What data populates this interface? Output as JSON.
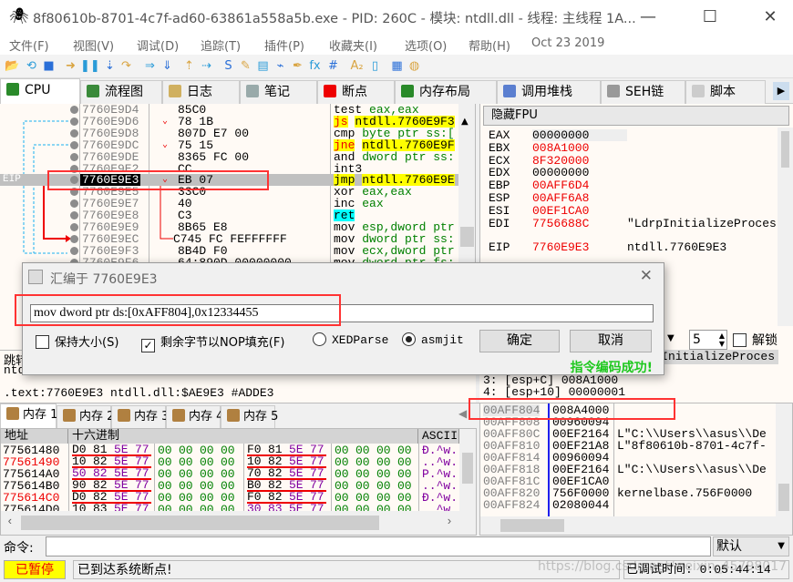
{
  "window": {
    "title": "8f80610b-8701-4c7f-ad60-63861a558a5b.exe - PID: 260C - 模块: ntdll.dll - 线程: 主线程 1A...",
    "minimize": "—",
    "maximize": "☐",
    "close": "✕"
  },
  "menu": [
    "文件(F)",
    "视图(V)",
    "调试(D)",
    "追踪(T)",
    "插件(P)",
    "收藏夹(I)",
    "选项(O)",
    "帮助(H)",
    "Oct 23 2019"
  ],
  "toolbar_icons": [
    "open-icon",
    "restart-icon",
    "stop-icon",
    "run-icon",
    "pause-icon",
    "step-into-icon",
    "step-over-icon",
    "trace-into-icon",
    "trace-over-icon",
    "run-to-user-icon",
    "animate-icon",
    "scylla-icon",
    "patch-icon",
    "comment-icon",
    "label-icon",
    "bookmark-icon",
    "function-icon",
    "hash-icon",
    "strings-icon",
    "calc-icon",
    "memory-icon",
    "globe-icon"
  ],
  "toolbar_glyphs": [
    "📂",
    "⟲",
    "■",
    "➜",
    "❚❚",
    "⇣",
    "↷",
    "⇒",
    "⇓",
    "⇡",
    "⇢",
    "S",
    "✎",
    "▤",
    "⌁",
    "✒",
    "fx",
    "#",
    "A₂",
    "▯",
    "▦",
    "◍"
  ],
  "tabs": [
    {
      "label": "CPU",
      "color": "#2a8a2a"
    },
    {
      "label": "流程图",
      "color": "#3a8a3a"
    },
    {
      "label": "日志",
      "color": "#d0b060"
    },
    {
      "label": "笔记",
      "color": "#9aa"
    },
    {
      "label": "断点",
      "color": "#e00"
    },
    {
      "label": "内存布局",
      "color": "#2a8a2a"
    },
    {
      "label": "调用堆栈",
      "color": "#5b7fd0"
    },
    {
      "label": "SEH链",
      "color": "#999"
    },
    {
      "label": "脚本",
      "color": "#ccc"
    }
  ],
  "disasm": {
    "eip_label": "EIP",
    "rows": [
      {
        "addr": "7760E9D4",
        "bytes": "85C0",
        "mn": "test",
        "op": "eax,eax"
      },
      {
        "addr": "7760E9D6",
        "bytes": "78 1B",
        "mn": "js",
        "op": "ntdll.7760E9F3",
        "jump": true
      },
      {
        "addr": "7760E9D8",
        "bytes": "807D E7 00",
        "mn": "cmp",
        "op": "byte ptr ss:["
      },
      {
        "addr": "7760E9DC",
        "bytes": "75 15",
        "mn": "jne",
        "op": "ntdll.7760E9F",
        "jump": true
      },
      {
        "addr": "7760E9DE",
        "bytes": "8365 FC 00",
        "mn": "and",
        "op": "dword ptr ss:"
      },
      {
        "addr": "7760E9E2",
        "bytes": "CC",
        "mn": "int3",
        "op": ""
      },
      {
        "addr": "7760E9E3",
        "bytes": "EB 07",
        "mn": "jmp",
        "op": "ntdll.7760E9E",
        "jump": true,
        "selected": true
      },
      {
        "addr": "7760E9E5",
        "bytes": "33C0",
        "mn": "xor",
        "op": "eax,eax"
      },
      {
        "addr": "7760E9E7",
        "bytes": "40",
        "mn": "inc",
        "op": "eax"
      },
      {
        "addr": "7760E9E8",
        "bytes": "C3",
        "mn": "ret",
        "op": ""
      },
      {
        "addr": "7760E9E9",
        "bytes": "8B65 E8",
        "mn": "mov",
        "op": "esp,dword ptr"
      },
      {
        "addr": "7760E9EC",
        "bytes": "C745 FC FEFFFFFF",
        "mn": "mov",
        "op": "dword ptr ss:"
      },
      {
        "addr": "7760E9F3",
        "bytes": "8B4D F0",
        "mn": "mov",
        "op": "ecx,dword ptr"
      },
      {
        "addr": "7760E9F6",
        "bytes": "64:890D 00000000",
        "mn": "mov",
        "op": "dword ptr fs:"
      }
    ]
  },
  "registers": {
    "hide_fpu": "隐藏FPU",
    "list": [
      {
        "name": "EAX",
        "value": "00000000",
        "changed": false,
        "comment": ""
      },
      {
        "name": "EBX",
        "value": "008A1000",
        "changed": true,
        "comment": ""
      },
      {
        "name": "ECX",
        "value": "8F320000",
        "changed": true,
        "comment": ""
      },
      {
        "name": "EDX",
        "value": "00000000",
        "changed": false,
        "comment": ""
      },
      {
        "name": "EBP",
        "value": "00AFF6D4",
        "changed": true,
        "comment": ""
      },
      {
        "name": "ESP",
        "value": "00AFF6A8",
        "changed": true,
        "comment": ""
      },
      {
        "name": "ESI",
        "value": "00EF1CA0",
        "changed": true,
        "comment": ""
      },
      {
        "name": "EDI",
        "value": "7756688C",
        "changed": true,
        "comment": "\"LdrpInitializeProcess"
      },
      {
        "name": "EIP",
        "value": "7760E9E3",
        "changed": true,
        "comment": "ntdll.7760E9E3"
      }
    ]
  },
  "dialog": {
    "title": "汇编于 7760E9E3",
    "input_value": "mov dword ptr ds:[0xAFF804],0x12334455",
    "keep_size": {
      "label": "保持大小(S)",
      "checked": false
    },
    "fill_nop": {
      "label": "剩余字节以NOP填充(F)",
      "checked": true
    },
    "xedparse": {
      "label": "XEDParse",
      "selected": false
    },
    "asmjit": {
      "label": "asmjit",
      "selected": true
    },
    "ok": "确定",
    "cancel": "取消",
    "message": "指令编码成功!",
    "close": "✕"
  },
  "info": {
    "line1": "跳转",
    "line2": "ntd",
    "line3": ".text:7760E9E3 ntdll.dll:$AE9E3 #ADDE3"
  },
  "args": {
    "count": "5",
    "unlock": "解锁",
    "lines": [
      "InitializeProces",
      "3: [esp+C] 008A1000",
      "4: [esp+10] 00000001"
    ]
  },
  "memtabs": [
    "内存 1",
    "内存 2",
    "内存 3",
    "内存 4",
    "内存 5"
  ],
  "hex": {
    "headers": [
      "地址",
      "十六进制",
      "ASCII"
    ],
    "rows": [
      {
        "addr": "77561480",
        "red": false,
        "bytes": [
          "D0",
          "81",
          "5E",
          "77",
          "00",
          "00",
          "00",
          "00",
          "F0",
          "81",
          "5E",
          "77",
          "00",
          "00",
          "00",
          "00"
        ],
        "ascii": "Đ.^w."
      },
      {
        "addr": "77561490",
        "red": true,
        "bytes": [
          "10",
          "82",
          "5E",
          "77",
          "00",
          "00",
          "00",
          "00",
          "10",
          "82",
          "5E",
          "77",
          "00",
          "00",
          "00",
          "00"
        ],
        "ascii": "..^w."
      },
      {
        "addr": "775614A0",
        "red": false,
        "bytes": [
          "50",
          "82",
          "5E",
          "77",
          "00",
          "00",
          "00",
          "00",
          "70",
          "82",
          "5E",
          "77",
          "00",
          "00",
          "00",
          "00"
        ],
        "ascii": "P.^w."
      },
      {
        "addr": "775614B0",
        "red": false,
        "bytes": [
          "90",
          "82",
          "5E",
          "77",
          "00",
          "00",
          "00",
          "00",
          "B0",
          "82",
          "5E",
          "77",
          "00",
          "00",
          "00",
          "00"
        ],
        "ascii": "..^w."
      },
      {
        "addr": "775614C0",
        "red": true,
        "bytes": [
          "D0",
          "82",
          "5E",
          "77",
          "00",
          "00",
          "00",
          "00",
          "F0",
          "82",
          "5E",
          "77",
          "00",
          "00",
          "00",
          "00"
        ],
        "ascii": "Đ.^w."
      },
      {
        "addr": "775614D0",
        "red": false,
        "bytes": [
          "10",
          "83",
          "5E",
          "77",
          "00",
          "00",
          "00",
          "00",
          "30",
          "83",
          "5E",
          "77",
          "00",
          "00",
          "00",
          "00"
        ],
        "ascii": "..^w."
      }
    ]
  },
  "stack": [
    {
      "addr": "00AFF804",
      "value": "008A4000",
      "comment": ""
    },
    {
      "addr": "00AFF808",
      "value": "00960094",
      "comment": ""
    },
    {
      "addr": "00AFF80C",
      "value": "00EF2164",
      "comment": "L\"C:\\\\Users\\\\asus\\\\De"
    },
    {
      "addr": "00AFF810",
      "value": "00EF21A8",
      "comment": "L\"8f80610b-8701-4c7f-"
    },
    {
      "addr": "00AFF814",
      "value": "00960094",
      "comment": ""
    },
    {
      "addr": "00AFF818",
      "value": "00EF2164",
      "comment": "L\"C:\\\\Users\\\\asus\\\\De"
    },
    {
      "addr": "00AFF81C",
      "value": "00EF1CA0",
      "comment": ""
    },
    {
      "addr": "00AFF820",
      "value": "756F0000",
      "comment": "kernelbase.756F0000"
    },
    {
      "addr": "00AFF824",
      "value": "02080044",
      "comment": ""
    }
  ],
  "command": {
    "label": "命令:",
    "value": "",
    "mode": "默认"
  },
  "status": {
    "state": "已暂停",
    "message": "已到达系统断点!",
    "time": "已调试时间:  0:05:44:14",
    "watermark": "https://blog.csdn.net/weixin_45798017"
  }
}
